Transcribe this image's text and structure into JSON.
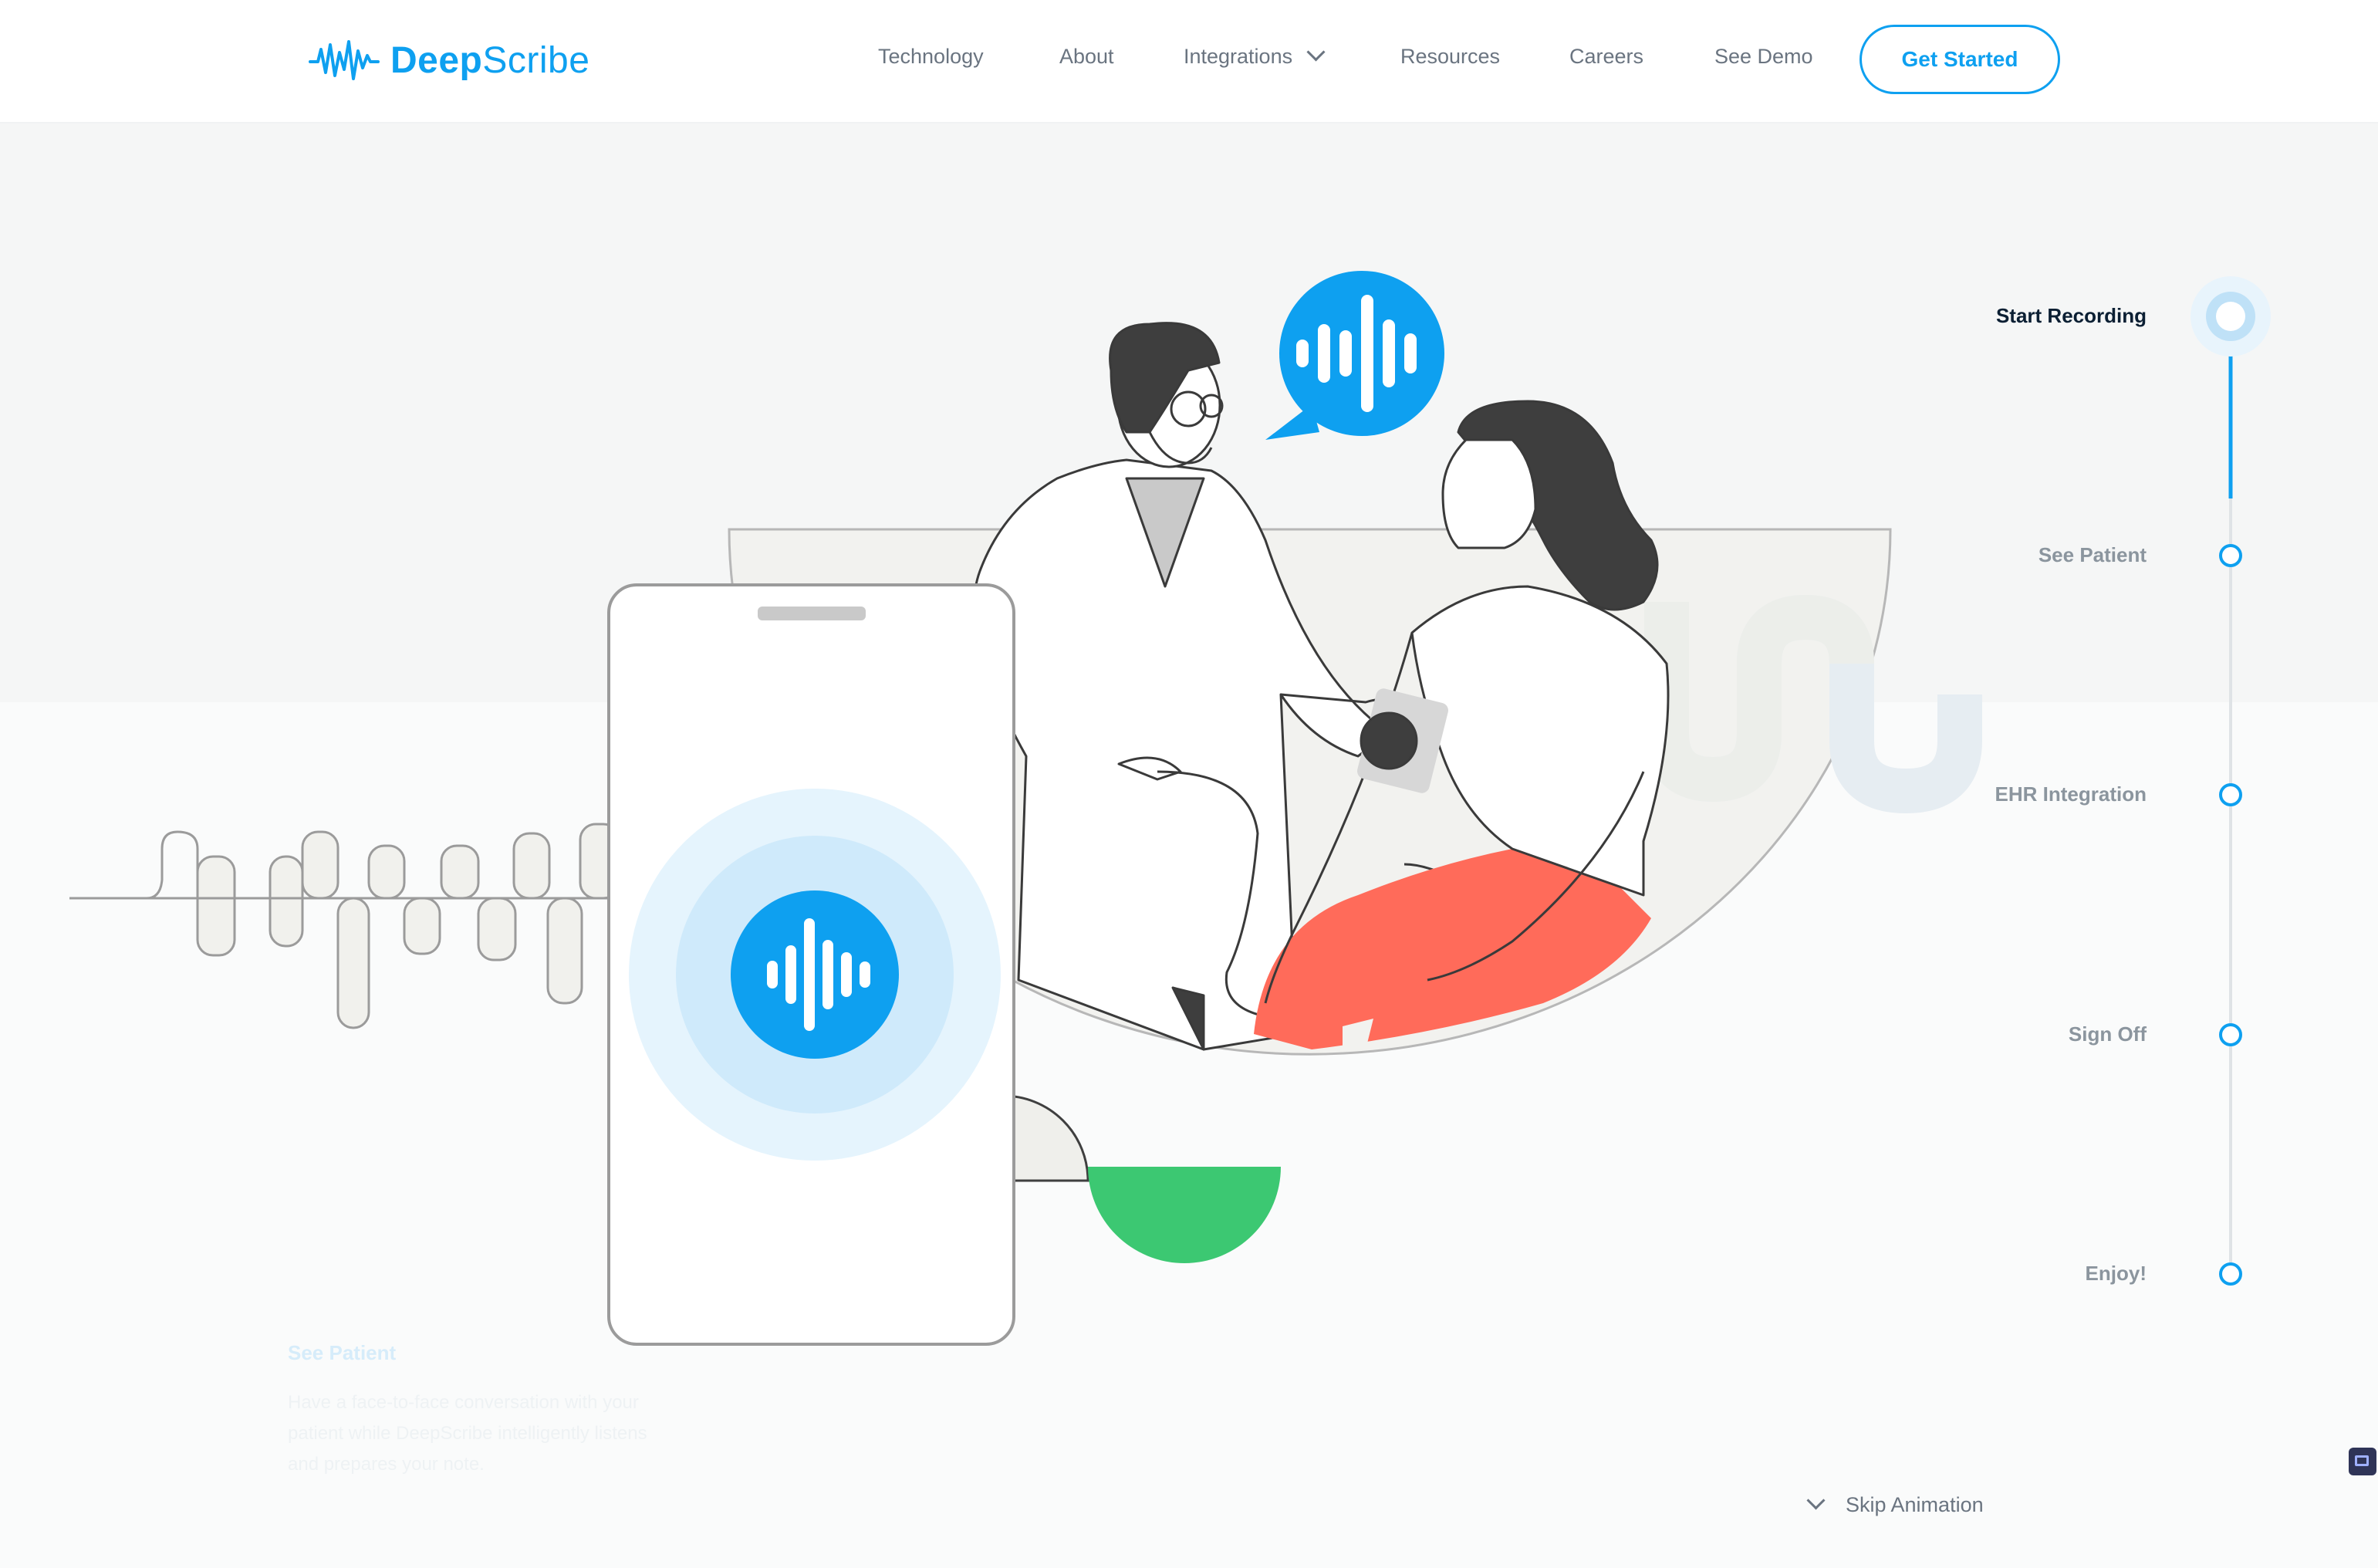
{
  "brand": {
    "name_bold": "Deep",
    "name_regular": "Scribe"
  },
  "nav": {
    "links": [
      "Technology",
      "About",
      "Integrations",
      "Resources",
      "Careers",
      "See Demo"
    ],
    "cta": "Get Started"
  },
  "steps": [
    "Start Recording",
    "See Patient",
    "EHR Integration",
    "Sign Off",
    "Enjoy!"
  ],
  "active_step": 0,
  "caption": {
    "title": "See Patient",
    "body": "Have a face-to-face conversation with your patient while DeepScribe intelligently listens and prepares your note."
  },
  "skip_label": "Skip Animation",
  "colors": {
    "accent": "#0ea0f0",
    "green": "#3cc872",
    "coral": "#ff6b5a",
    "dark": "#454545"
  },
  "icons": [
    "waveform-icon",
    "chevron-down-icon",
    "mic-waveform-icon",
    "speech-bubble-icon"
  ]
}
